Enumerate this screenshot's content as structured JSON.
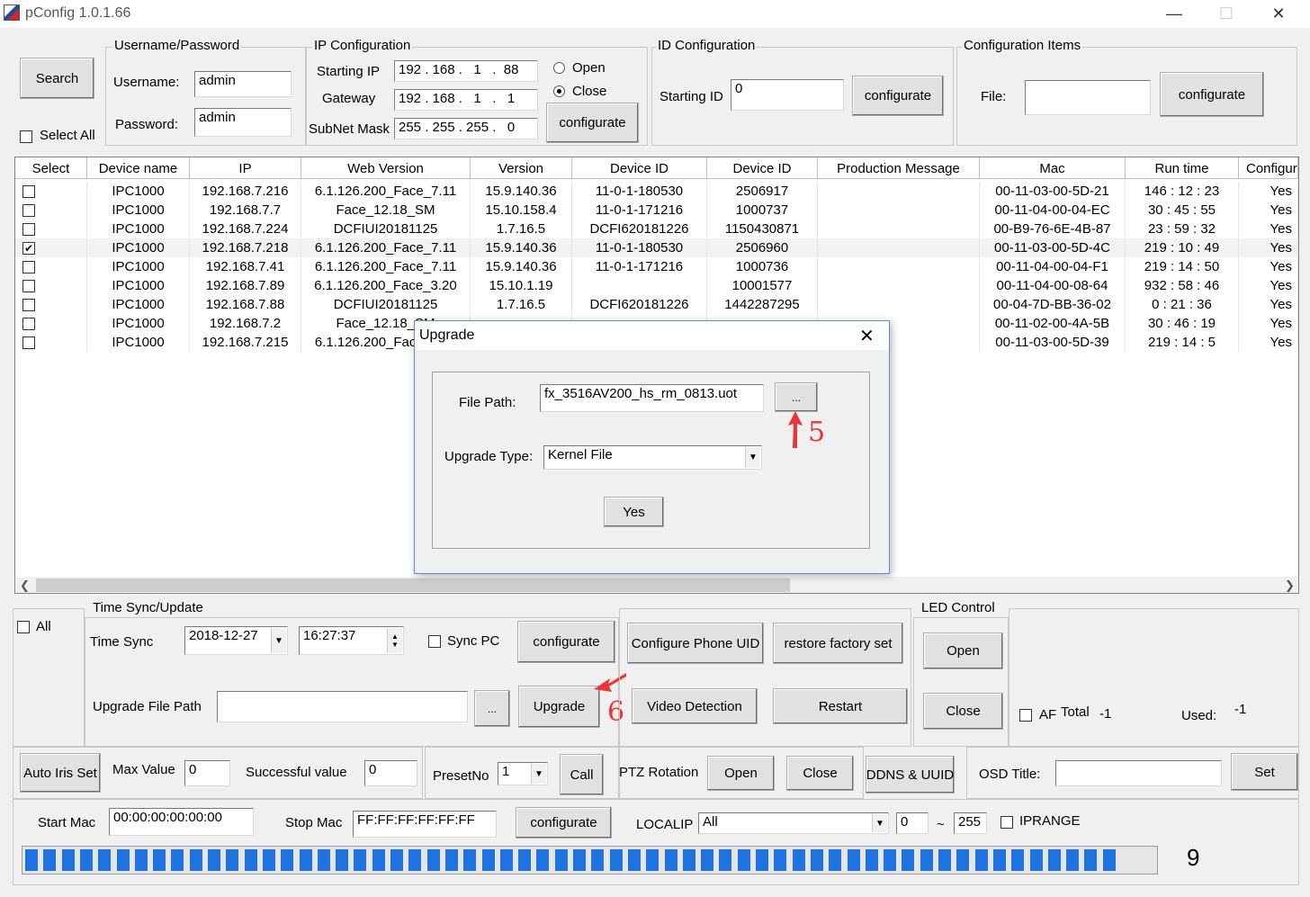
{
  "window": {
    "title": "pConfig  1.0.1.66"
  },
  "search_button": "Search",
  "select_all_label": "Select All",
  "credentials": {
    "group_label": "Username/Password",
    "username_label": "Username:",
    "username_value": "admin",
    "password_label": "Password:",
    "password_value": "admin"
  },
  "ip_config": {
    "group_label": "IP Configuration",
    "starting_ip_label": "Starting IP",
    "starting_ip": "192 . 168 .   1   .  88",
    "gateway_label": "Gateway",
    "gateway": "192 . 168 .   1   .   1",
    "subnet_label": "SubNet Mask",
    "subnet": "255 . 255 . 255 .   0",
    "open_label": "Open",
    "close_label": "Close",
    "configure_label": "configurate"
  },
  "id_config": {
    "group_label": "ID Configuration",
    "starting_id_label": "Starting ID",
    "starting_id": "0",
    "configure_label": "configurate"
  },
  "config_items": {
    "group_label": "Configuration Items",
    "file_label": "File:",
    "file_value": "",
    "configure_label": "configurate"
  },
  "table": {
    "headers": [
      "Select",
      "Device name",
      "IP",
      "Web Version",
      "Version",
      "Device ID",
      "Device ID",
      "Production Message",
      "Mac",
      "Run time",
      "Configur"
    ],
    "rows": [
      {
        "checked": false,
        "name": "IPC1000",
        "ip": "192.168.7.216",
        "web": "6.1.126.200_Face_7.11",
        "version": "15.9.140.36",
        "devid": "11-0-1-180530",
        "devid2": "2506917",
        "msg": "",
        "mac": "00-11-03-00-5D-21",
        "run": "146 : 12 : 23",
        "conf": "Yes"
      },
      {
        "checked": false,
        "name": "IPC1000",
        "ip": "192.168.7.7",
        "web": "Face_12.18_SM",
        "version": "15.10.158.4",
        "devid": "11-0-1-171216",
        "devid2": "1000737",
        "msg": "",
        "mac": "00-11-04-00-04-EC",
        "run": "30 : 45 : 55",
        "conf": "Yes"
      },
      {
        "checked": false,
        "name": "IPC1000",
        "ip": "192.168.7.224",
        "web": "DCFIUI20181125",
        "version": "1.7.16.5",
        "devid": "DCFI620181226",
        "devid2": "1150430871",
        "msg": "",
        "mac": "00-B9-76-6E-4B-87",
        "run": "23 : 59 : 32",
        "conf": "Yes"
      },
      {
        "checked": true,
        "name": "IPC1000",
        "ip": "192.168.7.218",
        "web": "6.1.126.200_Face_7.11",
        "version": "15.9.140.36",
        "devid": "11-0-1-180530",
        "devid2": "2506960",
        "msg": "",
        "mac": "00-11-03-00-5D-4C",
        "run": "219 : 10 : 49",
        "conf": "Yes"
      },
      {
        "checked": false,
        "name": "IPC1000",
        "ip": "192.168.7.41",
        "web": "6.1.126.200_Face_7.11",
        "version": "15.9.140.36",
        "devid": "11-0-1-171216",
        "devid2": "1000736",
        "msg": "",
        "mac": "00-11-04-00-04-F1",
        "run": "219 : 14 : 50",
        "conf": "Yes"
      },
      {
        "checked": false,
        "name": "IPC1000",
        "ip": "192.168.7.89",
        "web": "6.1.126.200_Face_3.20",
        "version": "15.10.1.19",
        "devid": "",
        "devid2": "10001577",
        "msg": "",
        "mac": "00-11-04-00-08-64",
        "run": "932 : 58 : 46",
        "conf": "Yes"
      },
      {
        "checked": false,
        "name": "IPC1000",
        "ip": "192.168.7.88",
        "web": "DCFIUI20181125",
        "version": "1.7.16.5",
        "devid": "DCFI620181226",
        "devid2": "1442287295",
        "msg": "",
        "mac": "00-04-7D-BB-36-02",
        "run": "0 : 21 : 36",
        "conf": "Yes"
      },
      {
        "checked": false,
        "name": "IPC1000",
        "ip": "192.168.7.2",
        "web": "Face_12.18_SM",
        "version": "",
        "devid": "",
        "devid2": "",
        "msg": "",
        "mac": "00-11-02-00-4A-5B",
        "run": "30 : 46 : 19",
        "conf": "Yes"
      },
      {
        "checked": false,
        "name": "IPC1000",
        "ip": "192.168.7.215",
        "web": "6.1.126.200_Face_7.11",
        "version": "",
        "devid": "",
        "devid2": "",
        "msg": "",
        "mac": "00-11-03-00-5D-39",
        "run": "219 : 14 : 5",
        "conf": "Yes"
      }
    ]
  },
  "upgrade_dialog": {
    "title": "Upgrade",
    "file_path_label": "File Path:",
    "file_path_value": "fx_3516AV200_hs_rm_0813.uot",
    "browse_label": "...",
    "upgrade_type_label": "Upgrade Type:",
    "upgrade_type_value": "Kernel File",
    "yes_label": "Yes",
    "annotation": "5"
  },
  "bottom": {
    "all_label": "All",
    "time_sync_group": "Time Sync/Update",
    "time_sync_label": "Time Sync",
    "date_value": "2018-12-27",
    "time_value": "16:27:37",
    "sync_pc_label": "Sync PC",
    "configure_label": "configurate",
    "upgrade_path_label": "Upgrade File Path",
    "upgrade_path_value": "",
    "browse_label": "...",
    "upgrade_label": "Upgrade",
    "annotation": "6",
    "phone_uid_label": "Configure Phone UID",
    "restore_label": "restore factory set",
    "video_detection_label": "Video Detection",
    "restart_label": "Restart",
    "led_group": "LED Control",
    "led_open": "Open",
    "led_close": "Close",
    "af_label": "AF",
    "total_label": "Total",
    "total_value": "-1",
    "used_label": "Used:",
    "used_value": "-1",
    "auto_iris_label": "Auto Iris Set",
    "max_value_label": "Max Value",
    "max_value": "0",
    "successful_label": "Successful value",
    "successful_value": "0",
    "preset_label": "PresetNo",
    "preset_value": "1",
    "call_label": "Call",
    "ptz_label": "PTZ Rotation",
    "ptz_open": "Open",
    "ptz_close": "Close",
    "ddns_label": "DDNS & UUID",
    "osd_label": "OSD Title:",
    "osd_value": "",
    "set_label": "Set",
    "start_mac_label": "Start Mac",
    "start_mac_value": "00:00:00:00:00:00",
    "stop_mac_label": "Stop Mac",
    "stop_mac_value": "FF:FF:FF:FF:FF:FF",
    "mac_configure_label": "configurate",
    "localip_label": "LOCALIP",
    "localip_value": "All",
    "range_from": "0",
    "range_sep": "~",
    "range_to": "255",
    "iprange_label": "IPRANGE",
    "progress_count": "9",
    "progress_fraction": 0.97
  }
}
